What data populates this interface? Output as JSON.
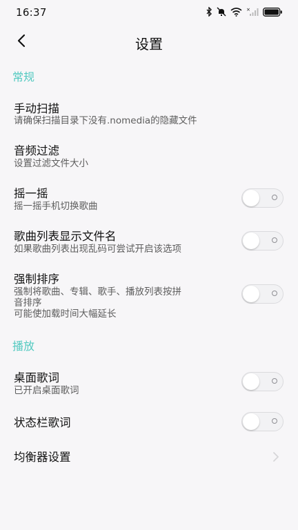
{
  "status_bar": {
    "time": "16:37",
    "icons": [
      "bluetooth-icon",
      "mute-icon",
      "wifi-icon",
      "signal-icon",
      "battery-icon"
    ]
  },
  "header": {
    "back_icon": "chevron-left-icon",
    "title": "设置"
  },
  "sections": {
    "general": {
      "label": "常规",
      "items": [
        {
          "title": "手动扫描",
          "subtitle": "请确保扫描目录下没有.nomedia的隐藏文件"
        },
        {
          "title": "音频过滤",
          "subtitle": "设置过滤文件大小"
        },
        {
          "title": "摇一摇",
          "subtitle": "摇一摇手机切换歌曲",
          "toggle": false
        },
        {
          "title": "歌曲列表显示文件名",
          "subtitle": "如果歌曲列表出现乱码可尝试开启该选项",
          "toggle": false
        },
        {
          "title": "强制排序",
          "subtitle_lines": [
            "强制将歌曲、专辑、歌手、播放列表按拼",
            "音排序",
            "可能使加载时间大幅延长"
          ],
          "toggle": false
        }
      ]
    },
    "playback": {
      "label": "播放",
      "items": [
        {
          "title": "桌面歌词",
          "subtitle": "已开启桌面歌词",
          "toggle": false
        },
        {
          "title": "状态栏歌词",
          "toggle": false
        },
        {
          "title": "均衡器设置",
          "chevron_icon": "chevron-right-icon"
        }
      ]
    }
  },
  "colors": {
    "accent": "#52c9c0",
    "background": "#f7f6f8",
    "toggle_track": "#f2f2f4"
  }
}
